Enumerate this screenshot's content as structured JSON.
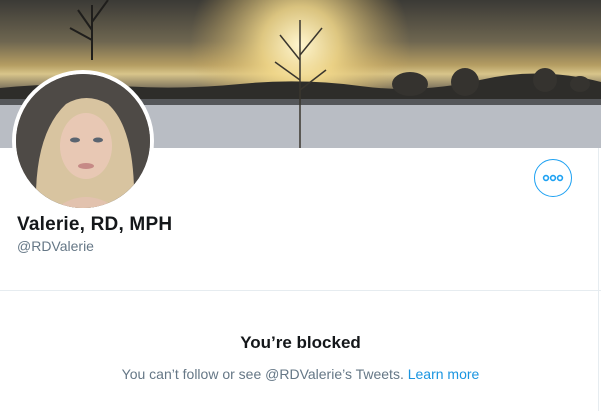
{
  "profile": {
    "display_name": "Valerie, RD, MPH",
    "handle": "@RDValerie"
  },
  "more_button": {
    "icon": "more-horizontal-icon"
  },
  "blocked": {
    "title": "You’re blocked",
    "message": "You can’t follow or see @RDValerie’s Tweets.",
    "link_label": "Learn more"
  },
  "colors": {
    "accent": "#1da1f2",
    "link": "#1b95e0",
    "secondary_text": "#657786",
    "primary_text": "#14171a",
    "divider": "#e6ecf0"
  }
}
